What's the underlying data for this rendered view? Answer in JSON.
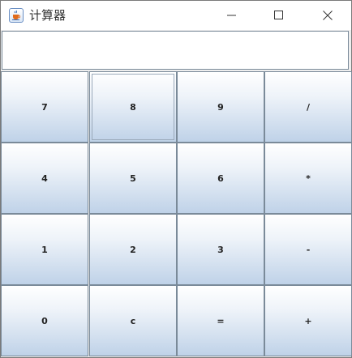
{
  "window": {
    "title": "计算器",
    "icon": "java-cup-icon"
  },
  "display": {
    "value": ""
  },
  "keys": [
    {
      "label": "7"
    },
    {
      "label": "8"
    },
    {
      "label": "9"
    },
    {
      "label": "/"
    },
    {
      "label": "4"
    },
    {
      "label": "5"
    },
    {
      "label": "6"
    },
    {
      "label": "*"
    },
    {
      "label": "1"
    },
    {
      "label": "2"
    },
    {
      "label": "3"
    },
    {
      "label": "-"
    },
    {
      "label": "0"
    },
    {
      "label": "c"
    },
    {
      "label": "="
    },
    {
      "label": "+"
    }
  ]
}
